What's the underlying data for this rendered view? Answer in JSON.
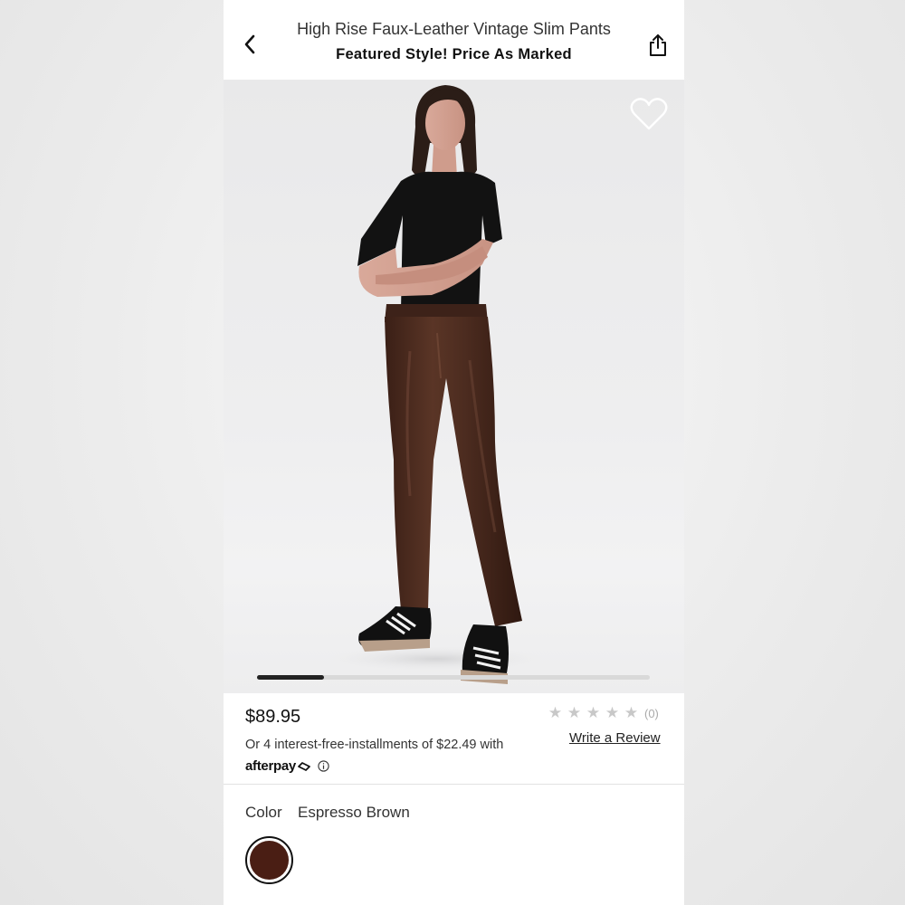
{
  "header": {
    "title": "High Rise Faux-Leather Vintage Slim Pants",
    "subtitle": "Featured Style! Price As Marked",
    "back_icon": "chevron-left-icon",
    "share_icon": "share-icon"
  },
  "gallery": {
    "favorite_icon": "heart-outline-icon",
    "current_slide": 1,
    "carousel_progress_fraction": 0.17
  },
  "pricing": {
    "price": "$89.95",
    "installments_text": "Or 4 interest-free-installments of $22.49 with",
    "afterpay_label": "afterpay",
    "info_icon": "info-icon"
  },
  "reviews": {
    "stars_filled": 0,
    "stars_total": 5,
    "count_text": "(0)",
    "write_review_label": "Write a Review"
  },
  "color": {
    "label": "Color",
    "selected_name": "Espresso Brown",
    "swatch_hex": "#4a1e14"
  },
  "colors": {
    "pants": "#4b2b1f",
    "top": "#101010",
    "background": "#ececec"
  }
}
